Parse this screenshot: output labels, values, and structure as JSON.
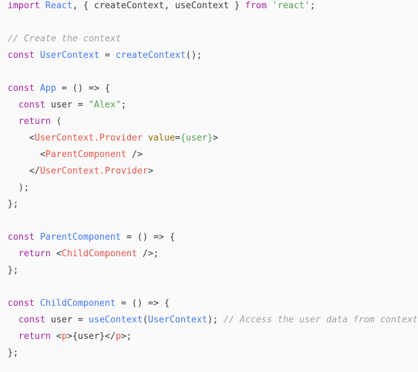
{
  "code_lines": [
    [
      [
        "kw",
        "import"
      ],
      [
        "pl",
        " "
      ],
      [
        "fn",
        "React"
      ],
      [
        "pl",
        ", { createContext, useContext } "
      ],
      [
        "kw",
        "from"
      ],
      [
        "pl",
        " "
      ],
      [
        "str",
        "'react'"
      ],
      [
        "pl",
        ";"
      ]
    ],
    [],
    [
      [
        "cm",
        "// Create the context"
      ]
    ],
    [
      [
        "kw",
        "const"
      ],
      [
        "pl",
        " "
      ],
      [
        "fn",
        "UserContext"
      ],
      [
        "pl",
        " = "
      ],
      [
        "fn",
        "createContext"
      ],
      [
        "pl",
        "();"
      ]
    ],
    [],
    [
      [
        "kw",
        "const"
      ],
      [
        "pl",
        " "
      ],
      [
        "fn",
        "App"
      ],
      [
        "pl",
        " = () => {"
      ]
    ],
    [
      [
        "pl",
        "  "
      ],
      [
        "kw",
        "const"
      ],
      [
        "pl",
        " user = "
      ],
      [
        "str",
        "\"Alex\""
      ],
      [
        "pl",
        ";"
      ]
    ],
    [
      [
        "pl",
        "  "
      ],
      [
        "kw",
        "return"
      ],
      [
        "pl",
        " ("
      ]
    ],
    [
      [
        "pl",
        "    <"
      ],
      [
        "tag",
        "UserContext.Provider"
      ],
      [
        "pl",
        " "
      ],
      [
        "attr",
        "value"
      ],
      [
        "pl",
        "="
      ],
      [
        "str",
        "{user}"
      ],
      [
        "pl",
        ">"
      ]
    ],
    [
      [
        "pl",
        "      <"
      ],
      [
        "tag",
        "ParentComponent"
      ],
      [
        "pl",
        " />"
      ]
    ],
    [
      [
        "pl",
        "    </"
      ],
      [
        "tag",
        "UserContext.Provider"
      ],
      [
        "pl",
        ">"
      ]
    ],
    [
      [
        "pl",
        "  );"
      ]
    ],
    [
      [
        "pl",
        "};"
      ]
    ],
    [],
    [
      [
        "kw",
        "const"
      ],
      [
        "pl",
        " "
      ],
      [
        "fn",
        "ParentComponent"
      ],
      [
        "pl",
        " = () => {"
      ]
    ],
    [
      [
        "pl",
        "  "
      ],
      [
        "kw",
        "return"
      ],
      [
        "pl",
        " <"
      ],
      [
        "tag",
        "ChildComponent"
      ],
      [
        "pl",
        " />;"
      ]
    ],
    [
      [
        "pl",
        "};"
      ]
    ],
    [],
    [
      [
        "kw",
        "const"
      ],
      [
        "pl",
        " "
      ],
      [
        "fn",
        "ChildComponent"
      ],
      [
        "pl",
        " = () => {"
      ]
    ],
    [
      [
        "pl",
        "  "
      ],
      [
        "kw",
        "const"
      ],
      [
        "pl",
        " user = "
      ],
      [
        "fn",
        "useContext"
      ],
      [
        "pl",
        "("
      ],
      [
        "fn",
        "UserContext"
      ],
      [
        "pl",
        "); "
      ],
      [
        "cm",
        "// Access the user data from context"
      ]
    ],
    [
      [
        "pl",
        "  "
      ],
      [
        "kw",
        "return"
      ],
      [
        "pl",
        " <"
      ],
      [
        "tag",
        "p"
      ],
      [
        "pl",
        ">{user}</"
      ],
      [
        "tag",
        "p"
      ],
      [
        "pl",
        ">;"
      ]
    ],
    [
      [
        "pl",
        "};"
      ]
    ]
  ]
}
